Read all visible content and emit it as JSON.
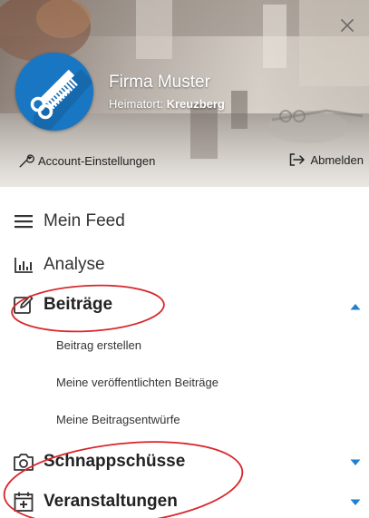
{
  "profile": {
    "company_name": "Firma Muster",
    "hometown_label": "Heimatort: ",
    "hometown_value": "Kreuzberg",
    "avatar_icon": "scissors-comb-icon",
    "avatar_color": "#1976c2"
  },
  "header_actions": {
    "account_settings": "Account-Einstellungen",
    "logout": "Abmelden",
    "close_icon": "close-icon"
  },
  "menu": {
    "feed": "Mein Feed",
    "analysis": "Analyse",
    "posts": {
      "label": "Beiträge",
      "expanded": true,
      "children": [
        "Beitrag erstellen",
        "Meine veröffentlichten Beiträge",
        "Meine Beitragsentwürfe"
      ]
    },
    "snapshots": {
      "label": "Schnappschüsse",
      "expanded": false
    },
    "events": {
      "label": "Veranstaltungen",
      "expanded": false
    }
  },
  "colors": {
    "accent": "#1f7fd0",
    "annotation": "#d8262b",
    "text": "#333333"
  }
}
